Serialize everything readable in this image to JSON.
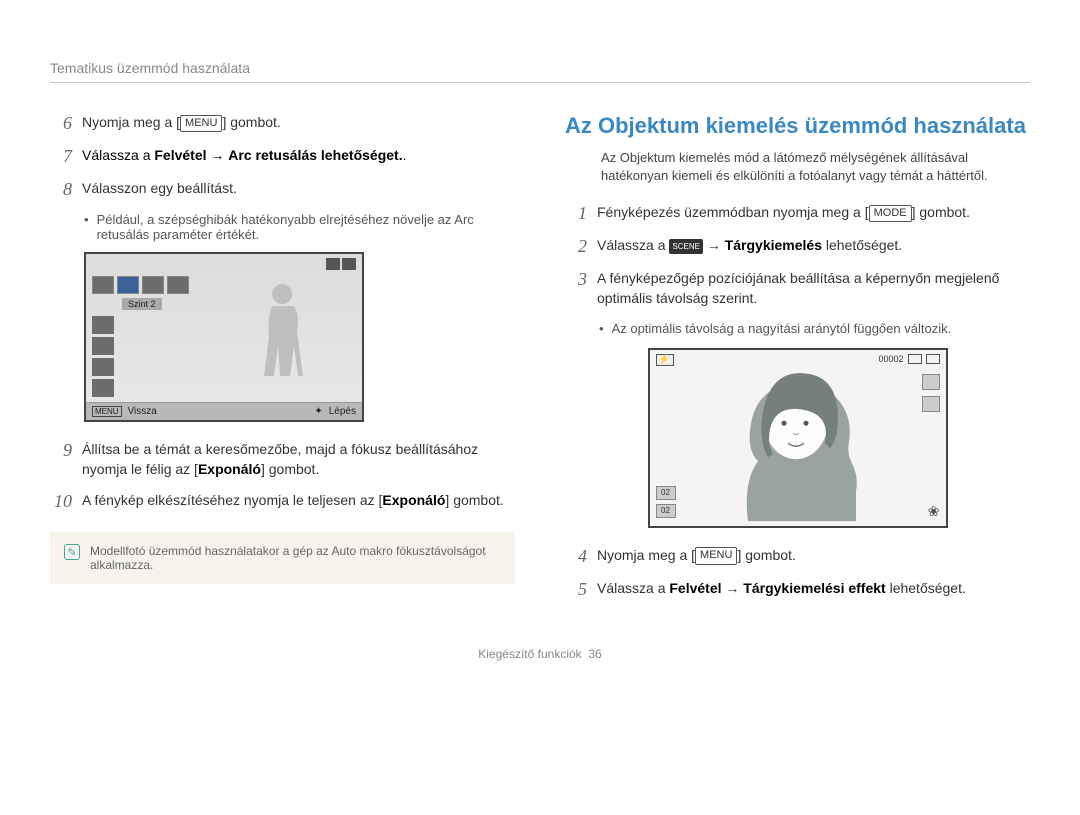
{
  "header": {
    "title": "Tematikus üzemmód használata"
  },
  "left": {
    "step6": {
      "pre": "Nyomja meg a [",
      "key": "MENU",
      "post": "] gombot."
    },
    "step7": {
      "pre": "Válassza a ",
      "bold1": "Felvétel",
      "arrow": " → ",
      "bold2": "Arc retusálás lehetőséget.",
      "post": "."
    },
    "step8": {
      "text": "Válasszon egy beállítást."
    },
    "step8_bullet": "Például, a szépséghibák hatékonyabb elrejtéséhez növelje az Arc retusálás paraméter értékét.",
    "lcd": {
      "level": "Szint 2",
      "back_key": "MENU",
      "back": "Vissza",
      "step": "Lépés"
    },
    "step9": {
      "pre": "Állítsa be a témát a keresőmezőbe, majd a fókusz beállításához nyomja le félig az [",
      "bold": "Exponáló",
      "post": "] gombot."
    },
    "step10": {
      "pre": "A fénykép elkészítéséhez nyomja le teljesen az [",
      "bold": "Exponáló",
      "post": "] gombot."
    },
    "note": "Modellfotó üzemmód használatakor a gép az Auto makro fókusztávolságot alkalmazza."
  },
  "right": {
    "title": "Az Objektum kiemelés üzemmód használata",
    "intro": "Az Objektum kiemelés mód a látómező mélységének állításával hatékonyan kiemeli és elkülöníti a fotóalanyt vagy témát a háttértől.",
    "step1": {
      "pre": "Fényképezés üzemmódban nyomja meg a [",
      "key": "MODE",
      "post": "] gombot."
    },
    "step2": {
      "pre": "Válassza a ",
      "arrow": " → ",
      "bold": "Tárgykiemelés",
      "post": " lehetőséget."
    },
    "step3": {
      "text": "A fényképezőgép pozíciójának beállítása a képernyőn megjelenő optimális távolság szerint."
    },
    "step3_bullet": "Az optimális távolság a nagyítási aránytól függően változik.",
    "lcd": {
      "counter": "00002"
    },
    "step4": {
      "pre": "Nyomja meg a [",
      "key": "MENU",
      "post": "] gombot."
    },
    "step5": {
      "pre": "Válassza a ",
      "bold1": "Felvétel",
      "arrow": " → ",
      "bold2": "Tárgykiemelési effekt",
      "post": " lehetőséget."
    }
  },
  "footer": {
    "section": "Kiegészítő funkciók",
    "page": "36"
  }
}
